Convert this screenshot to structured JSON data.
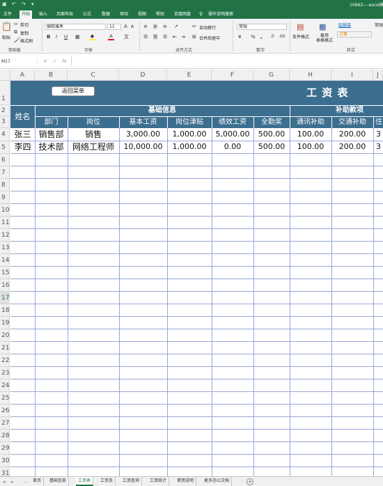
{
  "window": {
    "title": "10963----excel模"
  },
  "ribbon_tabs": [
    "文件",
    "开始",
    "插入",
    "页面布局",
    "公式",
    "数据",
    "审阅",
    "视图",
    "帮助",
    "百度网盘",
    "操作说明搜索"
  ],
  "active_tab": "开始",
  "ribbon": {
    "clipboard": {
      "paste": "粘贴",
      "cut": "剪切",
      "copy": "复制",
      "format_painter": "格式刷",
      "label": "剪贴板"
    },
    "font": {
      "name": "微软雅黑",
      "size": "11",
      "label": "字体",
      "bold": "B",
      "italic": "I",
      "underline": "U",
      "grow": "A",
      "shrink": "A"
    },
    "alignment": {
      "wrap": "自动换行",
      "merge": "合并后居中",
      "label": "对齐方式"
    },
    "number": {
      "format": "常规",
      "percent": "%",
      "comma": ",",
      "label": "数字"
    },
    "styles": {
      "conditional": "条件格式",
      "table": "套用\n表格格式",
      "hyperlink": "超链接",
      "calc": "计算",
      "normal": "常规",
      "label": "样式"
    }
  },
  "namebox": "M17",
  "columns": [
    "A",
    "B",
    "C",
    "D",
    "E",
    "F",
    "G",
    "H",
    "I",
    "J"
  ],
  "rows": [
    "1",
    "2",
    "3",
    "4",
    "5",
    "6",
    "7",
    "8",
    "9",
    "10",
    "11",
    "12",
    "13",
    "14",
    "15",
    "16",
    "17",
    "18",
    "19",
    "20",
    "21",
    "22",
    "23",
    "24",
    "25",
    "26",
    "27",
    "28",
    "29",
    "30",
    "31"
  ],
  "sheet": {
    "back_button": "返回菜单",
    "title": "工 资 表",
    "group_basic": "基础信息",
    "group_subsidy": "补助款项",
    "name_header": "姓名",
    "headers": [
      "部门",
      "岗位",
      "基本工资",
      "岗位津贴",
      "绩效工资",
      "全勤奖",
      "通讯补助",
      "交通补助",
      "住"
    ],
    "data": [
      [
        "张三",
        "销售部",
        "销售",
        "3,000.00",
        "1,000.00",
        "5,000.00",
        "500.00",
        "100.00",
        "200.00",
        "3"
      ],
      [
        "李四",
        "技术部",
        "网络工程师",
        "10,000.00",
        "1,000.00",
        "0.00",
        "500.00",
        "100.00",
        "200.00",
        "3"
      ]
    ]
  },
  "sheet_tabs": [
    "首页",
    "基础信息",
    "工资表",
    "工资条",
    "工资查询",
    "工资统计",
    "使用说明",
    "更多办公文档"
  ],
  "active_sheet": "工资表",
  "add_sheet": "+",
  "colors": {
    "excel_green": "#217346",
    "header_blue": "#3c6e8f",
    "grid": "#9aa6d6"
  }
}
